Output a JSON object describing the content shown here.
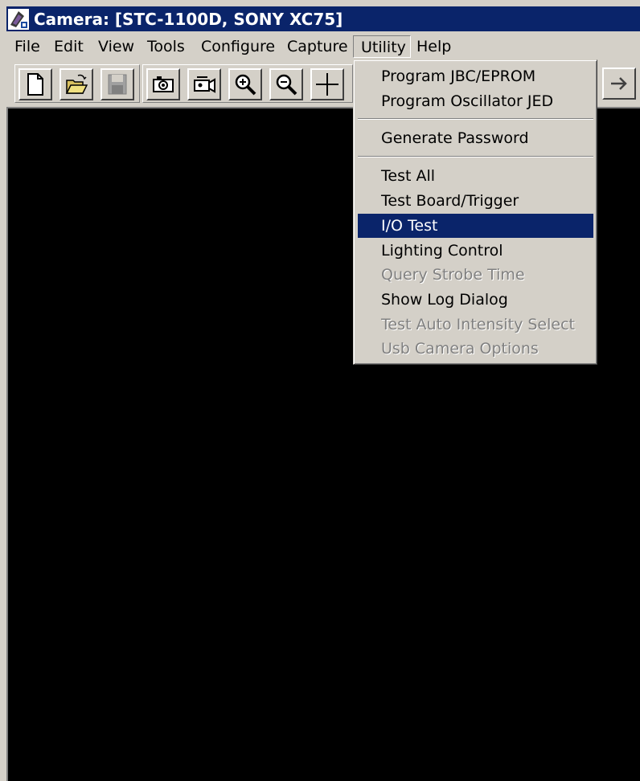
{
  "window": {
    "title": "Camera: [STC-1100D, SONY XC75]",
    "titlebar_color": "#0a246a",
    "icon": "camera-app-icon"
  },
  "menubar": {
    "items": [
      {
        "label": "File"
      },
      {
        "label": "Edit"
      },
      {
        "label": "View"
      },
      {
        "label": "Tools"
      },
      {
        "label": "Configure"
      },
      {
        "label": "Capture"
      },
      {
        "label": "Utility",
        "open": true
      },
      {
        "label": "Help"
      }
    ]
  },
  "toolbar": {
    "buttons": [
      {
        "icon": "new-document-icon"
      },
      {
        "icon": "open-folder-icon"
      },
      {
        "icon": "save-icon",
        "disabled": true
      },
      {
        "icon": "snapshot-camera-icon"
      },
      {
        "icon": "video-camera-icon"
      },
      {
        "icon": "zoom-in-icon"
      },
      {
        "icon": "zoom-out-icon"
      },
      {
        "icon": "crosshair-icon"
      },
      {
        "icon": "arrow-right-icon"
      }
    ]
  },
  "utility_menu": {
    "groups": [
      [
        {
          "label": "Program JBC/EPROM",
          "state": "enabled"
        },
        {
          "label": "Program Oscillator JED",
          "state": "enabled"
        }
      ],
      [
        {
          "label": "Generate Password",
          "state": "enabled"
        }
      ],
      [
        {
          "label": "Test All",
          "state": "enabled"
        },
        {
          "label": "Test Board/Trigger",
          "state": "enabled"
        },
        {
          "label": "I/O Test",
          "state": "selected"
        },
        {
          "label": "Lighting Control",
          "state": "enabled"
        },
        {
          "label": "Query Strobe Time",
          "state": "disabled"
        },
        {
          "label": "Show Log Dialog",
          "state": "enabled"
        },
        {
          "label": "Test Auto Intensity Select",
          "state": "disabled"
        },
        {
          "label": "Usb Camera Options",
          "state": "disabled"
        }
      ]
    ],
    "highlight_color": "#0a246a",
    "disabled_color": "#808080"
  }
}
